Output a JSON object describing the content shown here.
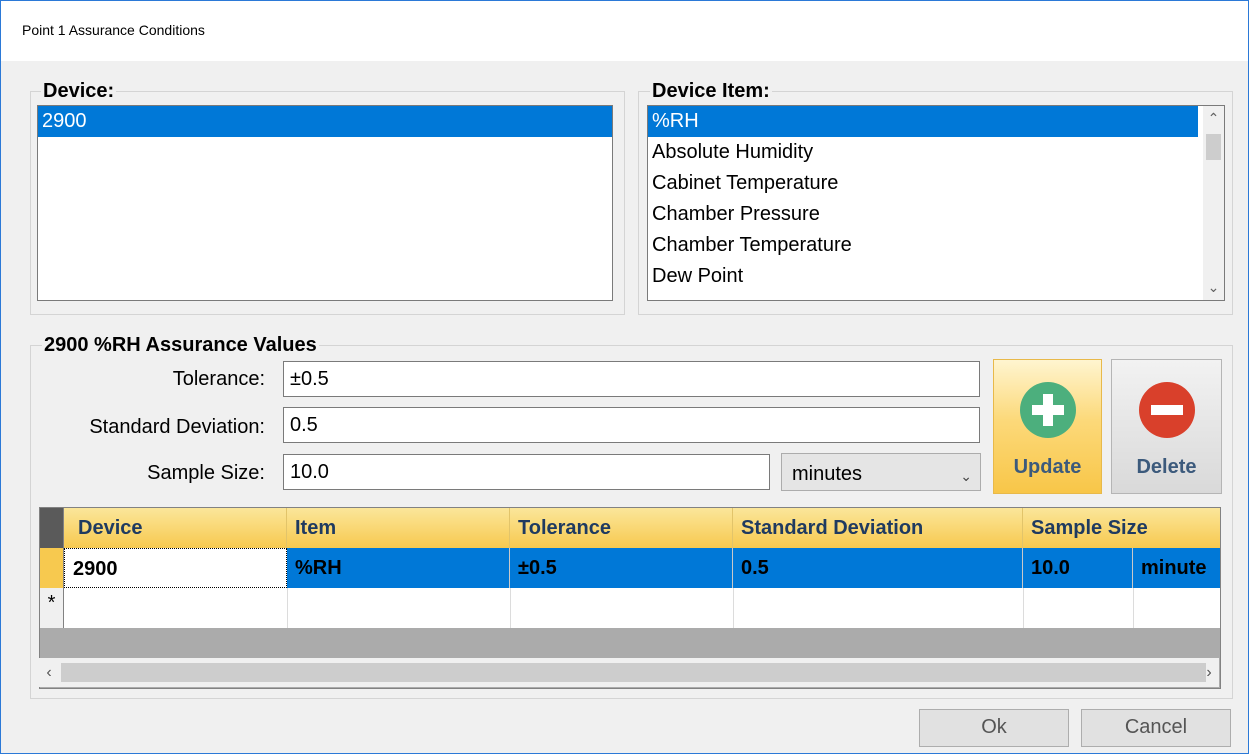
{
  "window": {
    "title": "Point 1 Assurance Conditions"
  },
  "device_group": {
    "label": "Device:",
    "items": [
      {
        "label": "2900",
        "selected": true
      }
    ]
  },
  "item_group": {
    "label": "Device Item:",
    "items": [
      {
        "label": "%RH",
        "selected": true
      },
      {
        "label": "Absolute Humidity"
      },
      {
        "label": "Cabinet Temperature"
      },
      {
        "label": "Chamber Pressure"
      },
      {
        "label": "Chamber Temperature"
      },
      {
        "label": "Dew Point"
      }
    ]
  },
  "values_group": {
    "label": "2900 %RH Assurance Values",
    "tolerance_label": "Tolerance:",
    "tolerance_value": "±0.5",
    "stddev_label": "Standard Deviation:",
    "stddev_value": "0.5",
    "sample_label": "Sample Size:",
    "sample_value": "10.0",
    "unit_selected": "minutes",
    "update_label": "Update",
    "delete_label": "Delete"
  },
  "grid": {
    "columns": [
      "Device",
      "Item",
      "Tolerance",
      "Standard Deviation",
      "Sample Size"
    ],
    "rows": [
      {
        "device": "2900",
        "item": "%RH",
        "tolerance": "±0.5",
        "stddev": "0.5",
        "sample": "10.0",
        "unit": "minute"
      }
    ],
    "new_row_marker": "*"
  },
  "footer": {
    "ok_label": "Ok",
    "cancel_label": "Cancel"
  },
  "colors": {
    "selection": "#0078d7",
    "header_gold": "#f7c94f",
    "add_green": "#4caf7d",
    "delete_red": "#d9402b"
  }
}
